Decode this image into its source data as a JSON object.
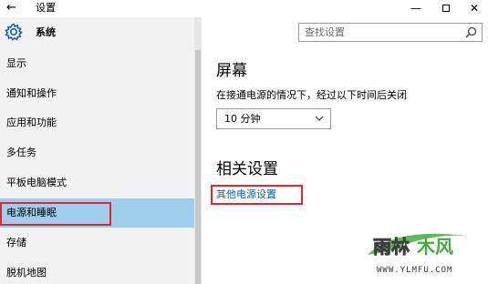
{
  "window": {
    "back_label": "←",
    "title": "设置",
    "minimize": "—",
    "maximize": "",
    "close": "✕"
  },
  "sidebar": {
    "title": "系统",
    "items": [
      {
        "label": "显示"
      },
      {
        "label": "通知和操作"
      },
      {
        "label": "应用和功能"
      },
      {
        "label": "多任务"
      },
      {
        "label": "平板电脑模式"
      },
      {
        "label": "电源和睡眠",
        "active": true
      },
      {
        "label": "存储"
      },
      {
        "label": "脱机地图"
      }
    ]
  },
  "search": {
    "placeholder": "查找设置",
    "icon": "search-icon"
  },
  "main": {
    "section_title": "屏幕",
    "description": "在接通电源的情况下，经过以下时间后关闭",
    "timeout_value": "10 分钟",
    "related_title": "相关设置",
    "related_link": "其他电源设置"
  },
  "watermark": {
    "text": "WWW.YLMFU.COM",
    "logo_text": "雨林木风"
  },
  "colors": {
    "sidebar_bg": "#f2f2f2",
    "active_item_bg": "#9fcdee",
    "link": "#0067b8",
    "highlight_border": "#e0282c",
    "watermark_green": "#3fae3a"
  }
}
